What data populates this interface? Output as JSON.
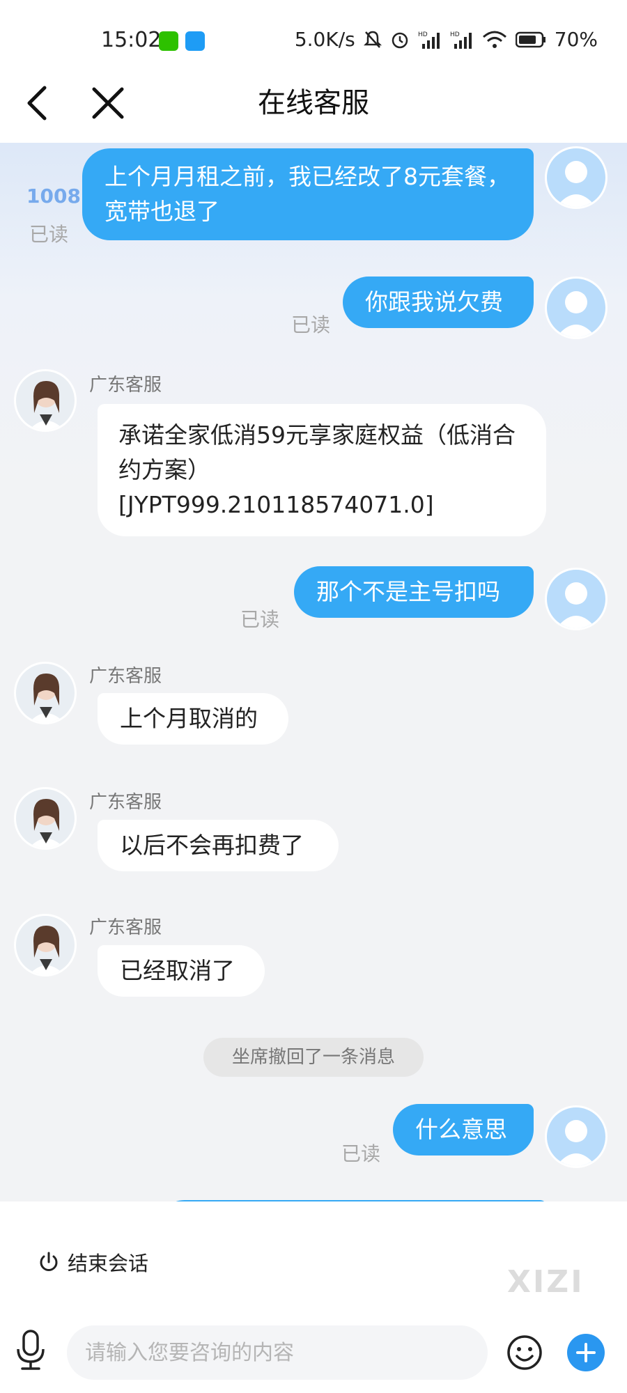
{
  "status_bar": {
    "time": "15:02",
    "network_speed": "5.0K/s",
    "battery": "70%",
    "icons": [
      "wechat-icon",
      "upload-app-icon",
      "mute-icon",
      "alarm-icon",
      "signal-hd-icon",
      "signal-hd-icon",
      "wifi-icon",
      "battery-icon"
    ]
  },
  "header": {
    "title": "在线客服",
    "back_icon": "chevron-left-icon",
    "close_icon": "close-icon"
  },
  "colors": {
    "outgoing_bubble": "#35a9f5",
    "incoming_bubble": "#ffffff",
    "chat_background": "#f2f3f5",
    "plus_button": "#2a97f0"
  },
  "corner_logo_text": "1008",
  "messages": [
    {
      "direction": "out",
      "text": "上个月月租之前，我已经改了8元套餐，宽带也退了",
      "read": "已读"
    },
    {
      "direction": "out",
      "text": "你跟我说欠费",
      "read": "已读"
    },
    {
      "direction": "in",
      "sender": "广东客服",
      "text": "承诺全家低消59元享家庭权益（低消合约方案）[JYPT999.210118574071.0]"
    },
    {
      "direction": "out",
      "text": "那个不是主号扣吗",
      "read": "已读"
    },
    {
      "direction": "in",
      "sender": "广东客服",
      "text": "上个月取消的"
    },
    {
      "direction": "in",
      "sender": "广东客服",
      "text": "以后不会再扣费了"
    },
    {
      "direction": "in",
      "sender": "广东客服",
      "text": "已经取消了"
    },
    {
      "direction": "system",
      "text": "坐席撤回了一条消息"
    },
    {
      "direction": "out",
      "text": "什么意思",
      "read": "已读"
    }
  ],
  "end_session": {
    "label": "结束会话",
    "icon": "power-icon"
  },
  "watermark": "XIZI",
  "input": {
    "placeholder": "请输入您要咨询的内容",
    "value": "",
    "mic_icon": "microphone-icon",
    "emoji_icon": "emoji-icon",
    "plus_icon": "plus-icon"
  }
}
